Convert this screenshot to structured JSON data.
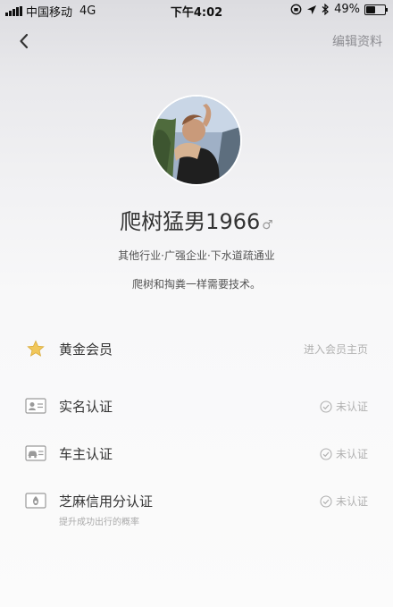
{
  "status_bar": {
    "carrier": "中国移动",
    "network": "4G",
    "time": "下午4:02",
    "battery_percent": "49%",
    "battery_level": 0.49
  },
  "nav": {
    "edit_label": "编辑资料"
  },
  "profile": {
    "name": "爬树猛男1966",
    "gender_symbol": "♂",
    "tags": "其他行业·广强企业·下水道疏通业",
    "bio": "爬树和掏粪一样需要技术。"
  },
  "rows": {
    "gold": {
      "label": "黄金会员",
      "action": "进入会员主页"
    },
    "realname": {
      "label": "实名认证",
      "status": "未认证"
    },
    "owner": {
      "label": "车主认证",
      "status": "未认证"
    },
    "sesame": {
      "label": "芝麻信用分认证",
      "sub": "提升成功出行的概率",
      "status": "未认证"
    }
  },
  "colors": {
    "star": "#f1c75b",
    "muted": "#b0b0b0"
  }
}
